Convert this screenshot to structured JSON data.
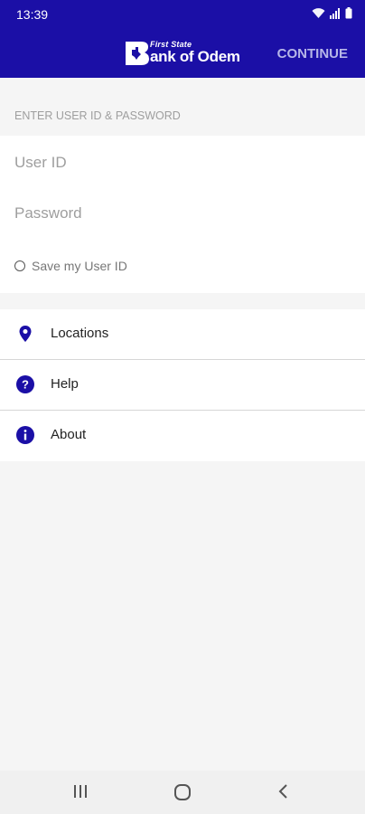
{
  "status_bar": {
    "time": "13:39",
    "icons": [
      "wifi-icon",
      "signal-icon",
      "battery-icon"
    ]
  },
  "app_bar": {
    "logo_line1": "First State",
    "logo_line2": "ank of Odem",
    "logo_initial": "B",
    "continue_label": "CONTINUE"
  },
  "login": {
    "section_title": "ENTER USER ID & PASSWORD",
    "user_id_placeholder": "User ID",
    "password_placeholder": "Password",
    "save_label": "Save my User ID"
  },
  "menu": {
    "items": [
      {
        "label": "Locations",
        "icon": "location-pin-icon"
      },
      {
        "label": "Help",
        "icon": "help-icon"
      },
      {
        "label": "About",
        "icon": "info-icon"
      }
    ]
  },
  "nav_bar": {
    "buttons": [
      "recents-icon",
      "home-icon",
      "back-icon"
    ]
  },
  "colors": {
    "primary": "#1b0fa6",
    "background": "#f5f5f5",
    "card": "#ffffff"
  }
}
